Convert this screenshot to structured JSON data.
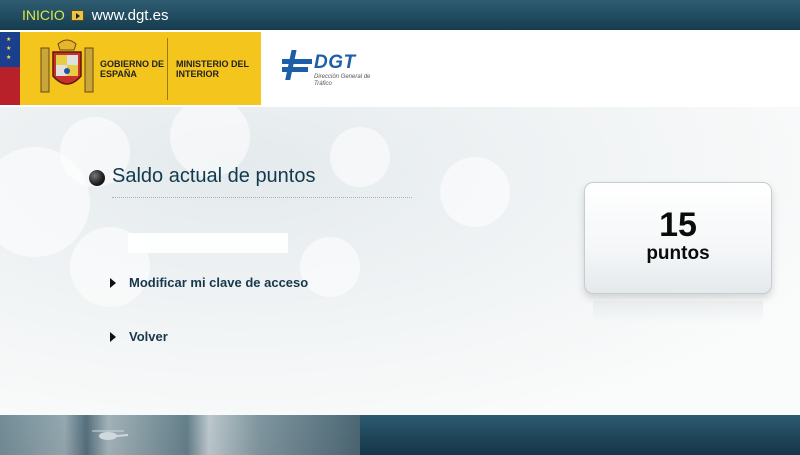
{
  "topbar": {
    "home_link": "INICIO",
    "site_link": "www.dgt.es",
    "icons": {
      "home": "play-icon"
    }
  },
  "header": {
    "gobierno": "GOBIERNO DE ESPAÑA",
    "ministerio": "MINISTERIO DEL INTERIOR",
    "dgt_title": "DGT",
    "dgt_subtitle": "Dirección General de Tráfico",
    "colors": {
      "gob_yellow": "#f4c51d",
      "dgt_blue": "#1d5ea8"
    }
  },
  "main": {
    "section_title": "Saldo actual de puntos",
    "links": [
      {
        "label": "Modificar mi clave de acceso"
      },
      {
        "label": "Volver"
      }
    ],
    "points": {
      "value": "15",
      "label": "puntos"
    }
  },
  "footer": {
    "icons": {
      "helicopter": "helicopter-icon"
    }
  }
}
